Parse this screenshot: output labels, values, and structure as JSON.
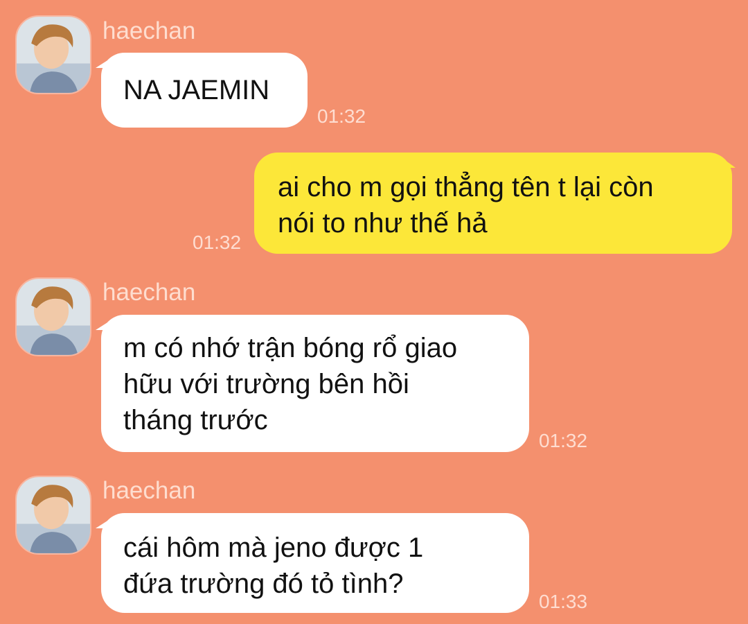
{
  "colors": {
    "background": "#F4906E",
    "incoming_bubble": "#FFFFFF",
    "outgoing_bubble": "#FCE739"
  },
  "messages": [
    {
      "sender": "haechan",
      "text": "NA JAEMIN",
      "time": "01:32",
      "avatar_icon": "user-photo-avatar"
    },
    {
      "sender": "",
      "text": "ai cho m gọi thẳng tên t lại còn\nnói to như thế hả",
      "time": "01:32"
    },
    {
      "sender": "haechan",
      "text": "m có nhớ trận bóng rổ giao\nhữu với trường bên hồi\ntháng trước",
      "time": "01:32",
      "avatar_icon": "user-photo-avatar"
    },
    {
      "sender": "haechan",
      "text": "cái hôm mà jeno được 1\nđứa trường đó tỏ tình?",
      "time": "01:33",
      "avatar_icon": "user-photo-avatar"
    }
  ]
}
